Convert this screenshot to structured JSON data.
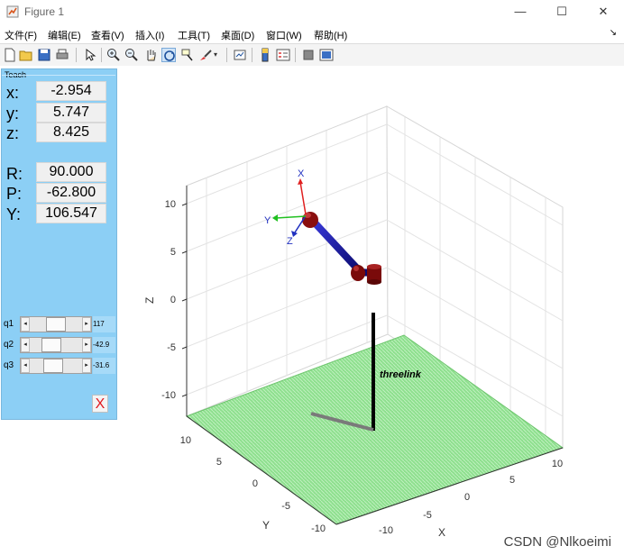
{
  "window": {
    "title": "Figure 1",
    "minimize": "—",
    "maximize": "☐",
    "close": "✕"
  },
  "menubar": {
    "items": [
      "文件(F)",
      "编辑(E)",
      "查看(V)",
      "插入(I)",
      "工具(T)",
      "桌面(D)",
      "窗口(W)",
      "帮助(H)"
    ]
  },
  "toolbar": {
    "icons": [
      "new-figure-icon",
      "open-file-icon",
      "save-icon",
      "print-icon",
      "pointer-icon",
      "zoom-in-icon",
      "zoom-out-icon",
      "pan-icon",
      "rotate-3d-icon",
      "data-cursor-icon",
      "brush-icon",
      "link-plot-icon",
      "insert-colorbar-icon",
      "insert-legend-icon",
      "hide-plot-tools-icon",
      "show-plot-tools-icon"
    ]
  },
  "teach": {
    "title": "Teach",
    "coords": [
      {
        "label": "x:",
        "value": "-2.954"
      },
      {
        "label": "y:",
        "value": "5.747"
      },
      {
        "label": "z:",
        "value": "8.425"
      }
    ],
    "angles": [
      {
        "label": "R:",
        "value": "90.000"
      },
      {
        "label": "P:",
        "value": "-62.800"
      },
      {
        "label": "Y:",
        "value": "106.547"
      }
    ],
    "joints": [
      {
        "label": "q1",
        "value": "117",
        "level": 0.5
      },
      {
        "label": "q2",
        "value": "-42.9",
        "level": 0.36
      },
      {
        "label": "q3",
        "value": "-31.6",
        "level": 0.41
      }
    ],
    "close_label": "X"
  },
  "plot": {
    "robot_name": "threelink",
    "z_ticks": [
      "10",
      "5",
      "0",
      "-5",
      "-10"
    ],
    "y_ticks": [
      "10",
      "5",
      "0",
      "-5",
      "-10"
    ],
    "x_ticks": [
      "-10",
      "-5",
      "0",
      "5",
      "10"
    ],
    "z_label": "Z",
    "y_label": "Y",
    "x_label": "X",
    "frame_labels": {
      "x": "X",
      "y": "Y",
      "z": "Z"
    },
    "colors": {
      "floor": "#8fe08f",
      "link": "#1414a0",
      "joint": "#7a0a0a",
      "panel": "#8ccff5"
    }
  },
  "watermark": "CSDN @Nlkoeimi"
}
